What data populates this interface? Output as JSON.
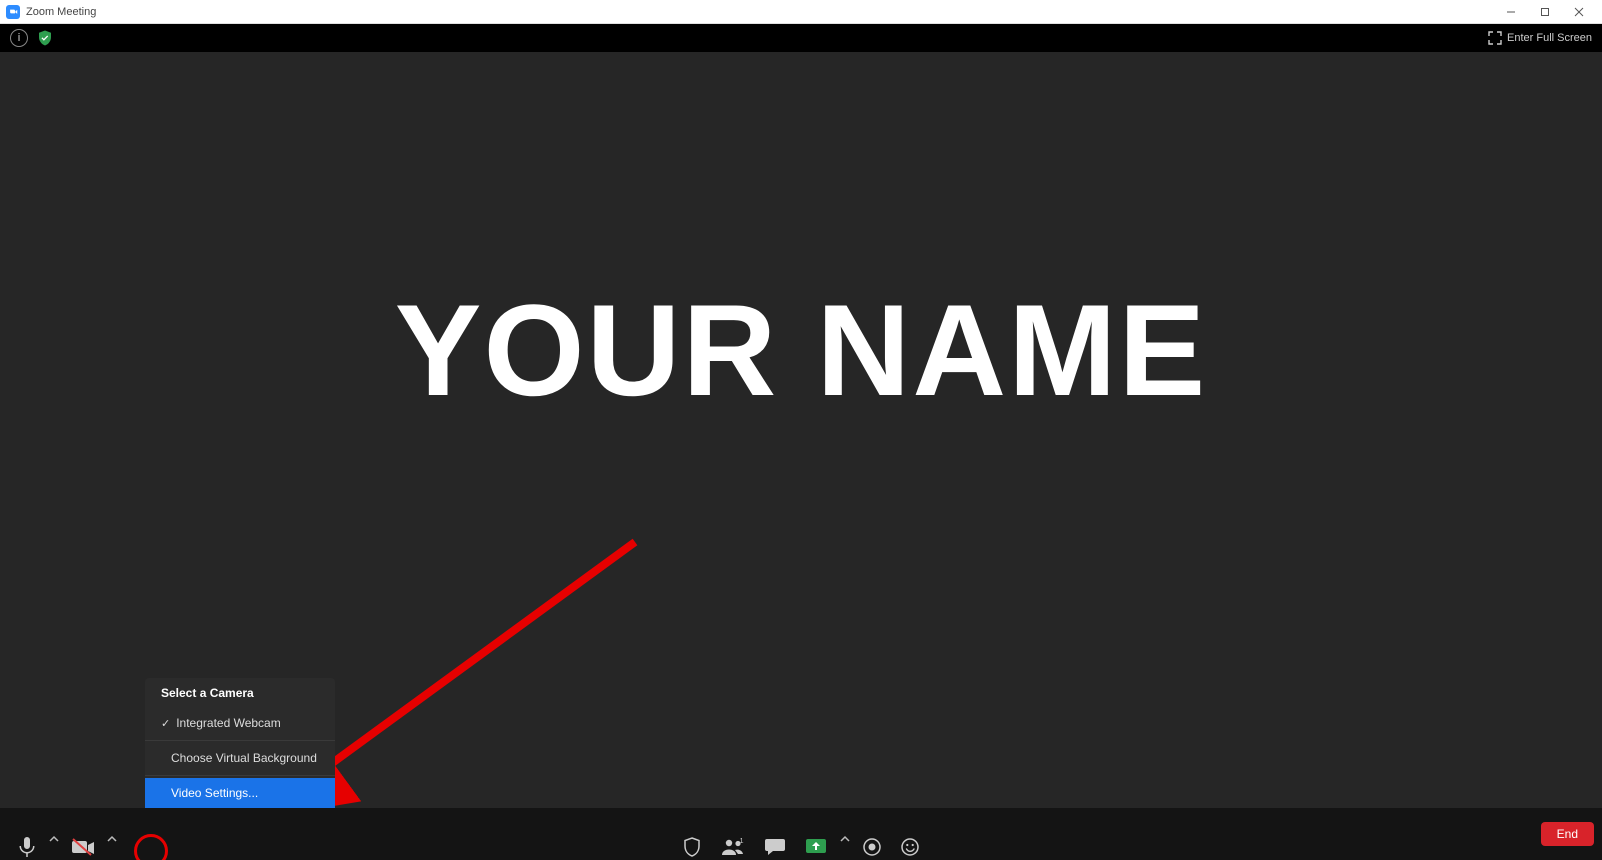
{
  "titlebar": {
    "title": "Zoom Meeting"
  },
  "topbar": {
    "info_glyph": "i",
    "fullscreen_label": "Enter Full Screen"
  },
  "main": {
    "display_name": "YOUR NAME"
  },
  "camera_menu": {
    "header": "Select a Camera",
    "camera_item": "Integrated Webcam",
    "virtual_bg": "Choose Virtual Background",
    "video_settings": "Video Settings..."
  },
  "bottombar": {
    "end_label": "End"
  }
}
